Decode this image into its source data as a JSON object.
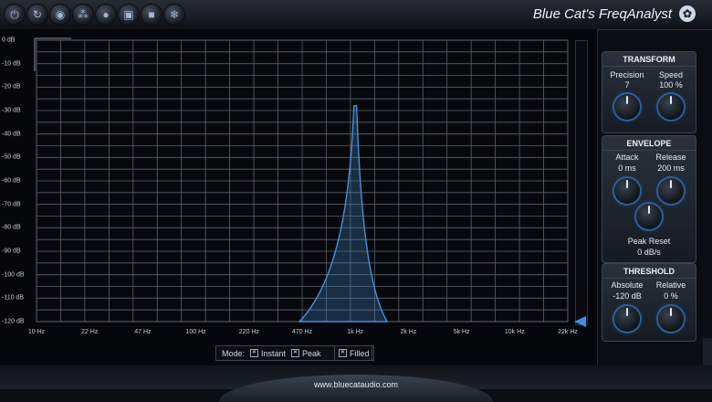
{
  "app": {
    "title": "Blue Cat's FreqAnalyst",
    "footer_url": "www.bluecataudio.com"
  },
  "toolbar": {
    "buttons": [
      {
        "name": "power-icon",
        "glyph": "⏻"
      },
      {
        "name": "refresh-icon",
        "glyph": "↻"
      },
      {
        "name": "record-icon",
        "glyph": "◉"
      },
      {
        "name": "nodes-icon",
        "glyph": "⁂"
      },
      {
        "name": "circle-icon",
        "glyph": "●"
      },
      {
        "name": "square-icon",
        "glyph": "▣"
      },
      {
        "name": "stop-icon",
        "glyph": "■"
      },
      {
        "name": "snowflake-icon",
        "glyph": "❄"
      }
    ]
  },
  "graph": {
    "y_labels": [
      "0 dB",
      "-10 dB",
      "-20 dB",
      "-30 dB",
      "-40 dB",
      "-50 dB",
      "-60 dB",
      "-70 dB",
      "-80 dB",
      "-90 dB",
      "-100 dB",
      "-110 dB",
      "-120 dB"
    ],
    "x_labels": [
      "10 Hz",
      "22 Hz",
      "47 Hz",
      "100 Hz",
      "220 Hz",
      "470 Hz",
      "1k Hz",
      "2k Hz",
      "5k Hz",
      "10k Hz",
      "22k Hz"
    ],
    "spectrum_color": "#4b8fd8",
    "peak_freq": "1k Hz",
    "peak_db": -28
  },
  "mode": {
    "label": "Mode:",
    "instant": "Instant",
    "peak": "Peak",
    "filled": "Filled"
  },
  "transform": {
    "title": "TRANSFORM",
    "precision_label": "Precision",
    "precision_value": "7",
    "speed_label": "Speed",
    "speed_value": "100 %"
  },
  "envelope": {
    "title": "ENVELOPE",
    "attack_label": "Attack",
    "attack_value": "0 ms",
    "release_label": "Release",
    "release_value": "200 ms",
    "peak_reset_label": "Peak Reset",
    "peak_reset_value": "0 dB/s"
  },
  "threshold": {
    "title": "THRESHOLD",
    "absolute_label": "Absolute",
    "absolute_value": "-120 dB",
    "relative_label": "Relative",
    "relative_value": "0 %"
  }
}
